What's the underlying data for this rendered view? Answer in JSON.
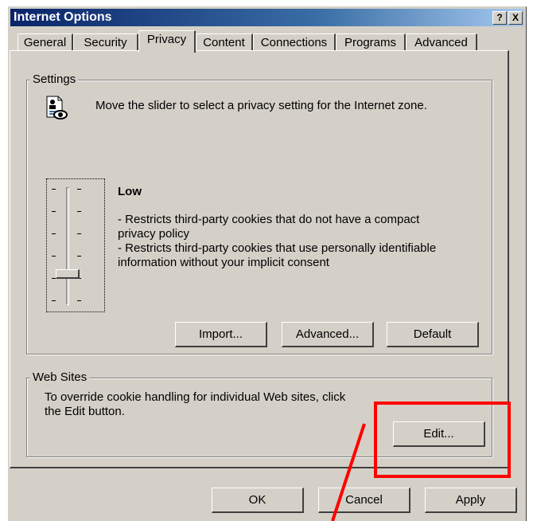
{
  "window": {
    "title": "Internet Options",
    "help_label": "?",
    "close_label": "X"
  },
  "tabs": [
    {
      "label": "General"
    },
    {
      "label": "Security"
    },
    {
      "label": "Privacy",
      "active": true
    },
    {
      "label": "Content"
    },
    {
      "label": "Connections"
    },
    {
      "label": "Programs"
    },
    {
      "label": "Advanced"
    }
  ],
  "settings": {
    "legend": "Settings",
    "description": "Move the slider to select a privacy setting for the Internet zone.",
    "level": "Low",
    "line1": "- Restricts third-party cookies that do not have a compact",
    "line2": "privacy policy",
    "line3": "- Restricts third-party cookies that use personally identifiable",
    "line4": "information without your implicit consent",
    "slider_position": "5 of 6",
    "import_label": "Import...",
    "advanced_label": "Advanced...",
    "default_label": "Default"
  },
  "websites": {
    "legend": "Web Sites",
    "line1": "To override cookie handling for individual Web sites, click",
    "line2": "the Edit button.",
    "edit_label": "Edit..."
  },
  "footer": {
    "ok_label": "OK",
    "cancel_label": "Cancel",
    "apply_label": "Apply"
  },
  "annotation": {
    "highlight_color": "#ff0000"
  },
  "icons": {
    "privacy": "privacy-document-eye-icon"
  }
}
